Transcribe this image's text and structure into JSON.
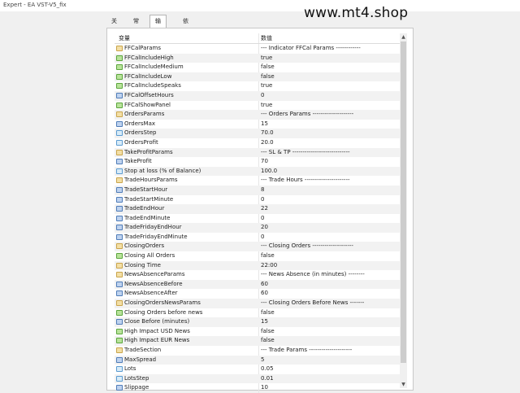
{
  "window": {
    "title": "Expert - EA VST-V5_fix"
  },
  "watermark": "www.mt4.shop",
  "tabs": [
    {
      "label": "关于",
      "active": false
    },
    {
      "label": "常用",
      "active": false
    },
    {
      "label": "输入参数",
      "active": true
    },
    {
      "label": "依存关系",
      "active": false
    }
  ],
  "table": {
    "col_variable": "变量",
    "col_value": "数值",
    "rows": [
      {
        "icon": "ab",
        "name": "FFCalParams",
        "value": "--- Indicator FFCal Params ------------"
      },
      {
        "icon": "bool",
        "name": "FFCalIncludeHigh",
        "value": "true"
      },
      {
        "icon": "bool",
        "name": "FFCalIncludeMedium",
        "value": "false"
      },
      {
        "icon": "bool",
        "name": "FFCalIncludeLow",
        "value": "false"
      },
      {
        "icon": "bool",
        "name": "FFCalIncludeSpeaks",
        "value": "true"
      },
      {
        "icon": "int",
        "name": "FFCalOffsetHours",
        "value": "0"
      },
      {
        "icon": "bool",
        "name": "FFCalShowPanel",
        "value": "true"
      },
      {
        "icon": "ab",
        "name": "OrdersParams",
        "value": "--- Orders Params --------------------"
      },
      {
        "icon": "int",
        "name": "OrdersMax",
        "value": "15"
      },
      {
        "icon": "dbl",
        "name": "OrdersStep",
        "value": "70.0"
      },
      {
        "icon": "dbl",
        "name": "OrdersProfit",
        "value": "20.0"
      },
      {
        "icon": "ab",
        "name": "TakeProfitParams",
        "value": "--- SL & TP ----------------------------"
      },
      {
        "icon": "int",
        "name": "TakeProfit",
        "value": "70"
      },
      {
        "icon": "dbl",
        "name": "Stop at loss (% of Balance)",
        "value": "100.0"
      },
      {
        "icon": "ab",
        "name": "TradeHoursParams",
        "value": "--- Trade Hours ----------------------"
      },
      {
        "icon": "int",
        "name": "TradeStartHour",
        "value": "8"
      },
      {
        "icon": "int",
        "name": "TradeStartMinute",
        "value": "0"
      },
      {
        "icon": "int",
        "name": "TradeEndHour",
        "value": "22"
      },
      {
        "icon": "int",
        "name": "TradeEndMinute",
        "value": "0"
      },
      {
        "icon": "int",
        "name": "TradeFridayEndHour",
        "value": "20"
      },
      {
        "icon": "int",
        "name": "TradeFridayEndMinute",
        "value": "0"
      },
      {
        "icon": "ab",
        "name": "ClosingOrders",
        "value": "--- Closing Orders --------------------"
      },
      {
        "icon": "bool",
        "name": "Closing All Orders",
        "value": "false"
      },
      {
        "icon": "ab",
        "name": "Closing Time",
        "value": "22:00"
      },
      {
        "icon": "ab",
        "name": "NewsAbsenceParams",
        "value": "--- News Absence (in minutes) --------"
      },
      {
        "icon": "int",
        "name": "NewsAbsenceBefore",
        "value": "60"
      },
      {
        "icon": "int",
        "name": "NewsAbsenceAfter",
        "value": "60"
      },
      {
        "icon": "ab",
        "name": "ClosingOrdersNewsParams",
        "value": "--- Closing Orders Before News -------"
      },
      {
        "icon": "bool",
        "name": "Closing Orders before news",
        "value": "false"
      },
      {
        "icon": "int",
        "name": "Close Before (minutes)",
        "value": "15"
      },
      {
        "icon": "bool",
        "name": "High Impact USD News",
        "value": "false"
      },
      {
        "icon": "bool",
        "name": "High Impact EUR News",
        "value": "false"
      },
      {
        "icon": "ab",
        "name": "TradeSection",
        "value": "--- Trade Params ---------------------"
      },
      {
        "icon": "int",
        "name": "MaxSpread",
        "value": "5"
      },
      {
        "icon": "dbl",
        "name": "Lots",
        "value": "0.05"
      },
      {
        "icon": "dbl",
        "name": "LotsStep",
        "value": "0.01"
      },
      {
        "icon": "int",
        "name": "Slippage",
        "value": "10"
      }
    ]
  }
}
